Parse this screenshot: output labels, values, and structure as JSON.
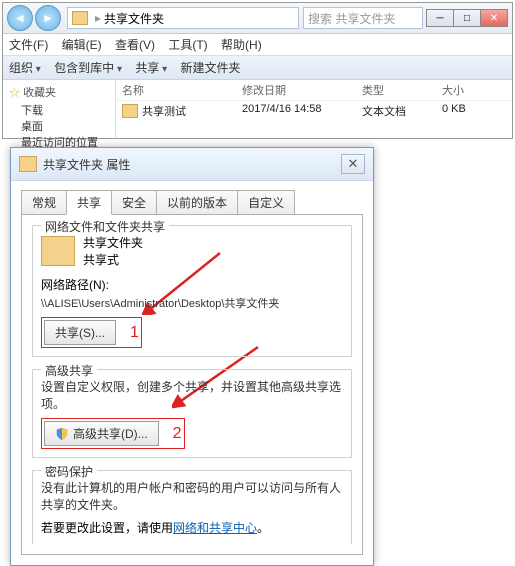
{
  "explorer": {
    "address_parts": [
      "共享文件夹"
    ],
    "search_placeholder": "搜索 共享文件夹",
    "menus": [
      "文件(F)",
      "编辑(E)",
      "查看(V)",
      "工具(T)",
      "帮助(H)"
    ],
    "toolbar": [
      "组织",
      "包含到库中",
      "共享",
      "新建文件夹"
    ],
    "sidebar": {
      "header": "收藏夹",
      "items": [
        "下载",
        "桌面",
        "最近访问的位置"
      ]
    },
    "columns": [
      "名称",
      "修改日期",
      "类型",
      "大小"
    ],
    "rows": [
      {
        "name": "共享测试",
        "date": "2017/4/16 14:58",
        "type": "文本文档",
        "size": "0 KB"
      }
    ]
  },
  "dialog": {
    "title": "共享文件夹 属性",
    "tabs": [
      "常规",
      "共享",
      "安全",
      "以前的版本",
      "自定义"
    ],
    "active_tab": 1,
    "network_group": {
      "legend": "网络文件和文件夹共享",
      "folder_name": "共享文件夹",
      "share_state": "共享式",
      "path_label": "网络路径(N):",
      "path_value": "\\\\ALISE\\Users\\Administrator\\Desktop\\共享文件夹",
      "share_button": "共享(S)...",
      "mark": "1"
    },
    "advanced_group": {
      "legend": "高级共享",
      "desc": "设置自定义权限，创建多个共享，并设置其他高级共享选项。",
      "button": "高级共享(D)...",
      "mark": "2"
    },
    "password_group": {
      "legend": "密码保护",
      "desc": "没有此计算机的用户帐户和密码的用户可以访问与所有人共享的文件夹。",
      "change_prefix": "若要更改此设置，请使用",
      "link": "网络和共享中心",
      "change_suffix": "。"
    }
  }
}
